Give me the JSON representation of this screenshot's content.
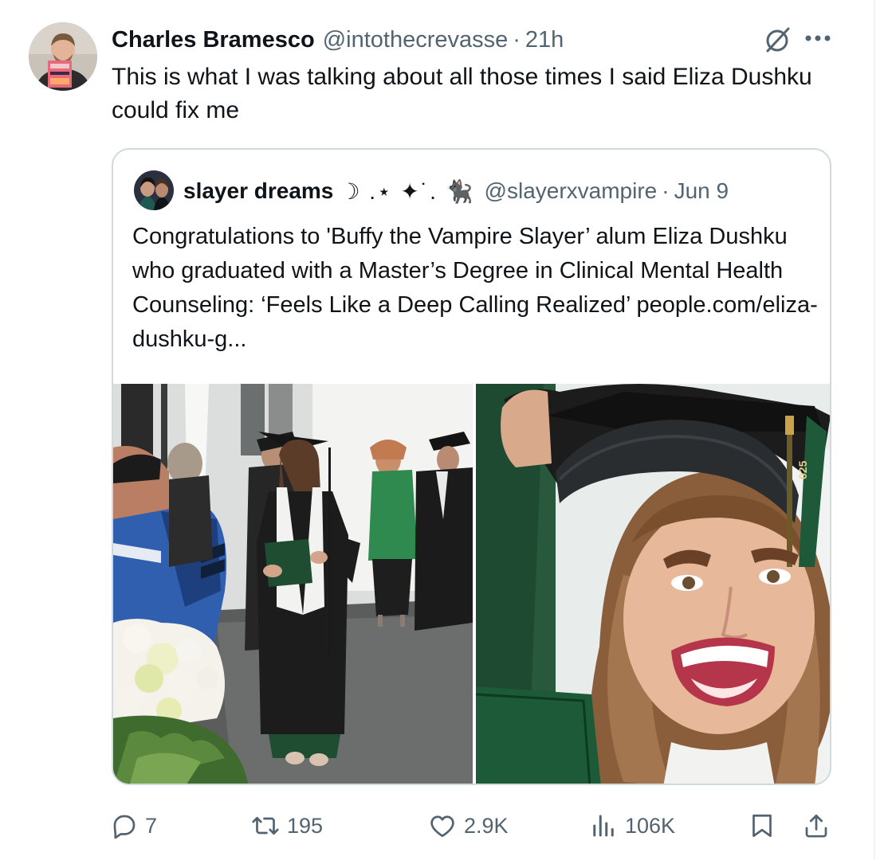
{
  "tweet": {
    "author": {
      "display_name": "Charles Bramesco",
      "handle": "@intothecrevasse",
      "separator": "·",
      "time": "21h"
    },
    "text": "This is what I was talking about all those times I said Eliza Dushku could fix me",
    "header_icons": [
      "grok-icon",
      "more-icon"
    ]
  },
  "quote": {
    "author": {
      "display_name": "slayer dreams",
      "decoration": "☽ .⋆ ✦˙. 🐈‍⬛",
      "handle": "@slayerxvampire",
      "separator": "·",
      "time": "Jun 9"
    },
    "text": "Congratulations to 'Buffy the Vampire Slayer’ alum Eliza Dushku who graduated with a Master’s Degree in Clinical Mental Health Counseling: ‘Feels Like a Deep Calling Realized’",
    "link": "people.com/eliza-dushku-g...",
    "media": {
      "left_photo": "graduation-stage-photo",
      "right_photo": "graduation-selfie-photo",
      "cap_tassel_text": "025"
    }
  },
  "actions": {
    "replies": "7",
    "reposts": "195",
    "likes": "2.9K",
    "views": "106K",
    "icons": [
      "reply-icon",
      "repost-icon",
      "like-icon",
      "views-icon",
      "bookmark-icon",
      "share-icon"
    ]
  },
  "colors": {
    "text_primary": "#0f1419",
    "text_secondary": "#536471",
    "border": "#cfd9de"
  }
}
